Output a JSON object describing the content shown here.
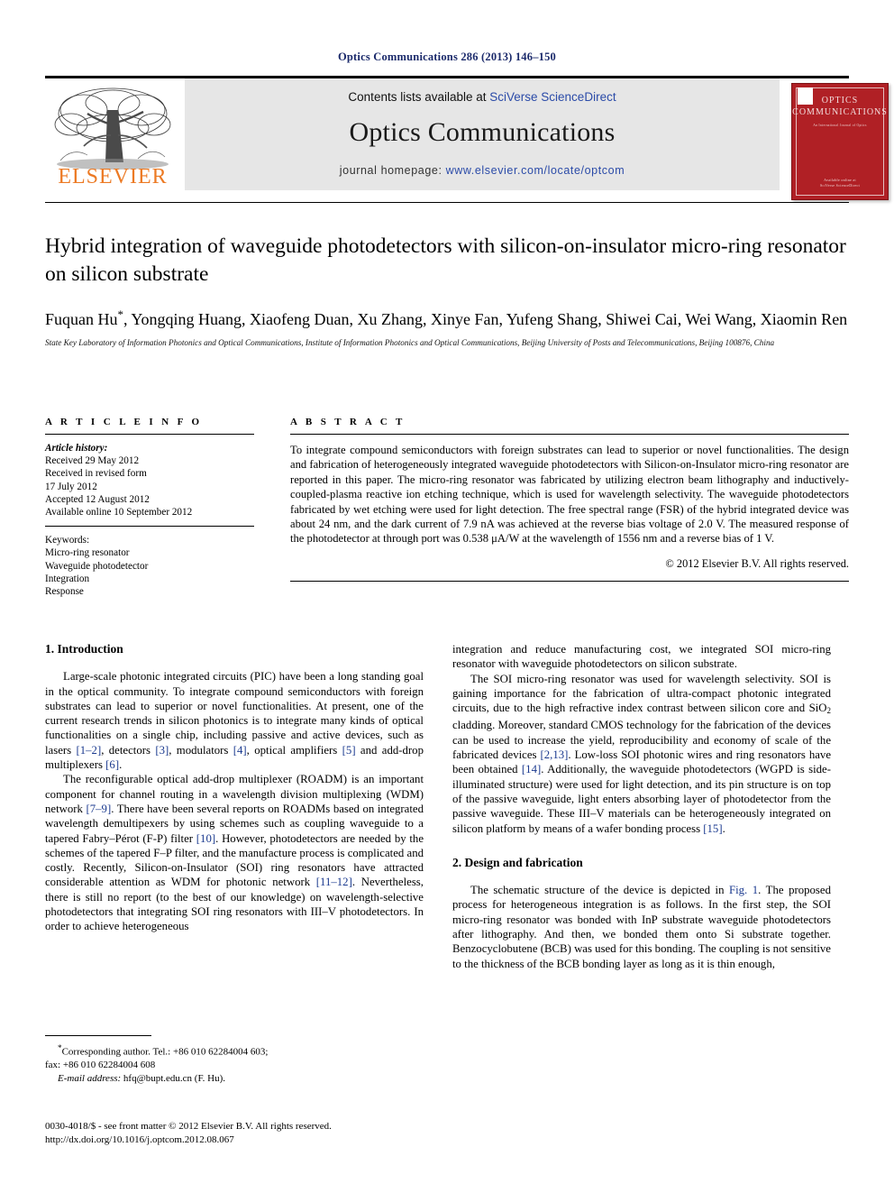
{
  "running_head": "Optics Communications 286 (2013) 146–150",
  "masthead": {
    "contents_prefix": "Contents lists available at ",
    "contents_link": "SciVerse ScienceDirect",
    "journal_name": "Optics Communications",
    "homepage_prefix": "journal homepage: ",
    "homepage_link": "www.elsevier.com/locate/optcom",
    "publisher_logo_text": "ELSEVIER",
    "cover": {
      "title_line1": "OPTICS",
      "title_line2": "COMMUNICATIONS",
      "subtitle": "An International Journal of Optics",
      "footer": "Available online at\nSciVerse ScienceDirect"
    }
  },
  "article": {
    "title": "Hybrid integration of waveguide photodetectors with silicon-on-insulator micro-ring resonator on silicon substrate",
    "authors": "Fuquan Hu*, Yongqing Huang, Xiaofeng Duan, Xu Zhang, Xinye Fan, Yufeng Shang, Shiwei Cai, Wei Wang, Xiaomin Ren",
    "affiliation": "State Key Laboratory of Information Photonics and Optical Communications, Institute of Information Photonics and Optical Communications, Beijing University of Posts and Telecommunications, Beijing 100876, China"
  },
  "article_info": {
    "heading": "A R T I C L E  I N F O",
    "history_label": "Article history:",
    "history": [
      "Received 29 May 2012",
      "Received in revised form",
      "17 July 2012",
      "Accepted 12 August 2012",
      "Available online 10 September 2012"
    ],
    "keywords_label": "Keywords:",
    "keywords": [
      "Micro-ring resonator",
      "Waveguide photodetector",
      "Integration",
      "Response"
    ]
  },
  "abstract": {
    "heading": "A B S T R A C T",
    "text": "To integrate compound semiconductors with foreign substrates can lead to superior or novel functionalities. The design and fabrication of heterogeneously integrated waveguide photodetectors with Silicon-on-Insulator micro-ring resonator are reported in this paper. The micro-ring resonator was fabricated by utilizing electron beam lithography and inductively-coupled-plasma reactive ion etching technique, which is used for wavelength selectivity. The waveguide photodetectors fabricated by wet etching were used for light detection. The free spectral range (FSR) of the hybrid integrated device was about 24 nm, and the dark current of 7.9 nA was achieved at the reverse bias voltage of 2.0 V. The measured response of the photodetector at through port was 0.538 μA/W at the wavelength of 1556 nm and a reverse bias of 1 V.",
    "copyright": "© 2012 Elsevier B.V. All rights reserved."
  },
  "body": {
    "section1_heading": "1.  Introduction",
    "section2_heading": "2.  Design and fabrication",
    "left_paragraphs": [
      "Large-scale photonic integrated circuits (PIC) have been a long standing goal in the optical community. To integrate compound semiconductors with foreign substrates can lead to superior or novel functionalities. At present, one of the current research trends in silicon photonics is to integrate many kinds of optical functionalities on a single chip, including passive and active devices, such as lasers [1–2], detectors [3], modulators [4], optical amplifiers [5] and add-drop multiplexers [6].",
      "The reconfigurable optical add-drop multiplexer (ROADM) is an important component for channel routing in a wavelength division multiplexing (WDM) network [7–9]. There have been several reports on ROADMs based on integrated wavelength demultipexers by using schemes such as coupling waveguide to a tapered Fabry–Pérot (F-P) filter [10]. However, photodetectors are needed by the schemes of the tapered F–P filter, and the manufacture process is complicated and costly. Recently, Silicon-on-Insulator (SOI) ring resonators have attracted considerable attention as WDM for photonic network [11–12]. Nevertheless, there is still no report (to the best of our knowledge) on wavelength-selective photodetectors that integrating SOI ring resonators with III–V photodetectors. In order to achieve heterogeneous"
    ],
    "right_paragraphs": [
      "integration and reduce manufacturing cost, we integrated SOI micro-ring resonator with waveguide photodetectors on silicon substrate.",
      "The SOI micro-ring resonator was used for wavelength selectivity. SOI is gaining importance for the fabrication of ultra-compact photonic integrated circuits, due to the high refractive index contrast between silicon core and SiO2 cladding. Moreover, standard CMOS technology for the fabrication of the devices can be used to increase the yield, reproducibility and economy of scale of the fabricated devices [2,13]. Low-loss SOI photonic wires and ring resonators have been obtained [14]. Additionally, the waveguide photodetectors (WGPD is side-illuminated structure) were used for light detection, and its pin structure is on top of the passive waveguide, light enters absorbing layer of photodetector from the passive waveguide. These III–V materials can be heterogeneously integrated on silicon platform by means of a wafer bonding process [15].",
      "The schematic structure of the device is depicted in Fig. 1. The proposed process for heterogeneous integration is as follows. In the first step, the SOI micro-ring resonator was bonded with InP substrate waveguide photodetectors after lithography. And then, we bonded them onto Si substrate together. Benzocyclobutene (BCB) was used for this bonding. The coupling is not sensitive to the thickness of the BCB bonding layer as long as it is thin enough,"
    ]
  },
  "footnote": {
    "corresponding": "*Corresponding author. Tel.: +86 010 62284004 603;",
    "fax": "fax: +86 010 62284004 608",
    "email_label": "E-mail address:",
    "email": "hfq@bupt.edu.cn (F. Hu)."
  },
  "footer": {
    "issn_line": "0030-4018/$ - see front matter © 2012 Elsevier B.V. All rights reserved.",
    "doi_line": "http://dx.doi.org/10.1016/j.optcom.2012.08.067"
  },
  "colors": {
    "running_head": "#1b2a6b",
    "link": "#2b4ba8",
    "reference": "#1b3a8f",
    "elsevier_orange": "#ec7a24",
    "cover_red": "#b02025",
    "masthead_bg": "#e6e6e6"
  }
}
